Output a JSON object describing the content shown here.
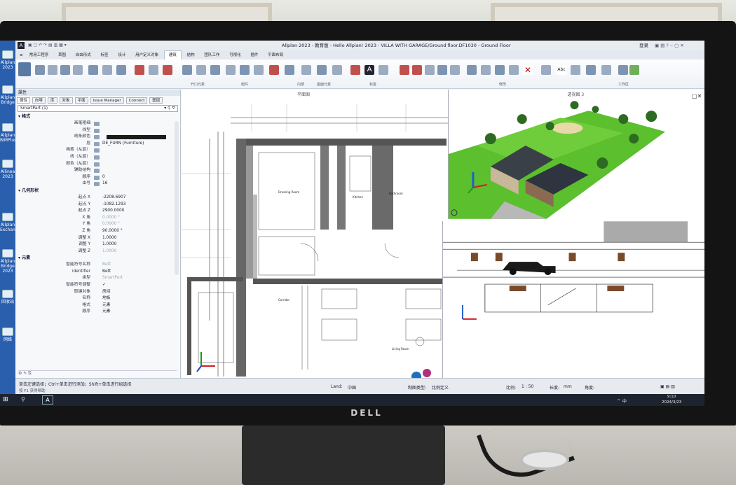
{
  "window": {
    "title": "Allplan 2023 - 教育版 - Hello Allplan! 2023 - VILLA WITH GARAGE/Ground floor.DF1030 - Ground Floor",
    "login": "登录"
  },
  "ribbon": {
    "tabs": [
      "常用工程序",
      "草图",
      "自由形式",
      "标签",
      "设计",
      "用户定义对象",
      "建筑",
      "结构",
      "团队工作",
      "可视化",
      "插件",
      "平面布局"
    ],
    "active_tab": "建筑",
    "groups": [
      "开口元素",
      "组件",
      "内部",
      "屋面元素",
      "标签",
      "修改",
      "工作区"
    ]
  },
  "left_panel": {
    "header": "属性",
    "tabs": [
      "属性",
      "向导",
      "库",
      "对象",
      "平面",
      "Issue Manager",
      "Connect",
      "图层"
    ],
    "selection": "SmartPart (1)",
    "sections": {
      "format": {
        "title": "格式",
        "rows": [
          {
            "k": "画笔粗细",
            "v": ""
          },
          {
            "k": "线型",
            "v": ""
          },
          {
            "k": "线条颜色",
            "v": ""
          },
          {
            "k": "层",
            "v": "DE_FURN (Furniture)"
          },
          {
            "k": "画笔（从层）",
            "v": ""
          },
          {
            "k": "线（从层）",
            "v": ""
          },
          {
            "k": "颜色（从层）",
            "v": ""
          },
          {
            "k": "辅助结构",
            "v": ""
          },
          {
            "k": "顺序",
            "v": "0"
          },
          {
            "k": "由号",
            "v": "16"
          }
        ]
      },
      "geometry": {
        "title": "几何形状",
        "rows": [
          {
            "k": "起点 X",
            "v": "-2208.6907"
          },
          {
            "k": "起点 Y",
            "v": "-1082.1293"
          },
          {
            "k": "起点 Z",
            "v": "2900.0000"
          },
          {
            "k": "X 角",
            "v": "0.0000 °"
          },
          {
            "k": "Y 角",
            "v": "0.0000 °"
          },
          {
            "k": "Z 角",
            "v": "90.0000 °"
          },
          {
            "k": "调整 X",
            "v": "1.0000"
          },
          {
            "k": "调整 Y",
            "v": "1.0000"
          },
          {
            "k": "调整 Z",
            "v": "1.0000"
          }
        ]
      },
      "element": {
        "title": "元素",
        "rows": [
          {
            "k": "智能符号名称",
            "v": "Bett"
          },
          {
            "k": "identifier",
            "v": "Bett"
          },
          {
            "k": "类型",
            "v": "SmartPart"
          },
          {
            "k": "智能符号调整",
            "v": "✓"
          },
          {
            "k": "取键对象",
            "v": "房间"
          },
          {
            "k": "名称",
            "v": "地板"
          },
          {
            "k": "格式",
            "v": "元素"
          },
          {
            "k": "顺序",
            "v": "元素"
          }
        ]
      }
    }
  },
  "viewport": {
    "plan_tab": "平面图",
    "v3d_tab": "透视图 3",
    "rooms": [
      "Dressing Room",
      "Kitchen",
      "Bathroom",
      "Corridor",
      "Living Room"
    ]
  },
  "statusbar": {
    "hint": "单击左键选择；Ctrl+单击进行添加；Shift+单击进行组选择",
    "help": "按 F1 获得帮助",
    "land_label": "Land:",
    "land": "中国",
    "drawing_type_label": "制图类型:",
    "drawing_type": "比例定义",
    "scale_label": "比例:",
    "scale": "1 : 50",
    "length_label": "长度:",
    "angle_label": "角度:",
    "unit": "mm"
  },
  "taskbar": {
    "app": "A",
    "tray": "^ 中",
    "time": "9:10",
    "date": "2024/3/23"
  },
  "monitor": {
    "brand": "DELL"
  },
  "desktop_icons": [
    "Allplan 2023",
    "Allplan Bridge",
    "Allplan BIMPlus",
    "Allinea 2023",
    "Allplan Exchange",
    "Allplan Bridge 2023",
    "回收站",
    "网络"
  ]
}
